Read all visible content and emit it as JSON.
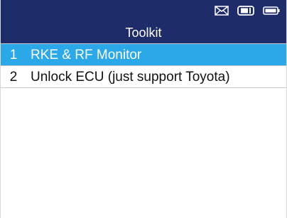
{
  "status_bar": {
    "icons": [
      "mail-icon",
      "vci-connection-icon",
      "battery-icon"
    ],
    "colors": {
      "background": "#1f2c6a",
      "icon": "#ffffff"
    }
  },
  "header": {
    "title": "Toolkit"
  },
  "menu": {
    "selected_index": 0,
    "items": [
      {
        "number": "1",
        "label": "RKE & RF Monitor"
      },
      {
        "number": "2",
        "label": "Unlock ECU (just support Toyota)"
      }
    ]
  },
  "colors": {
    "header_bg": "#1f2c6a",
    "selection_bg": "#2aa8e8",
    "text": "#111111",
    "divider": "#c8c8c8"
  }
}
